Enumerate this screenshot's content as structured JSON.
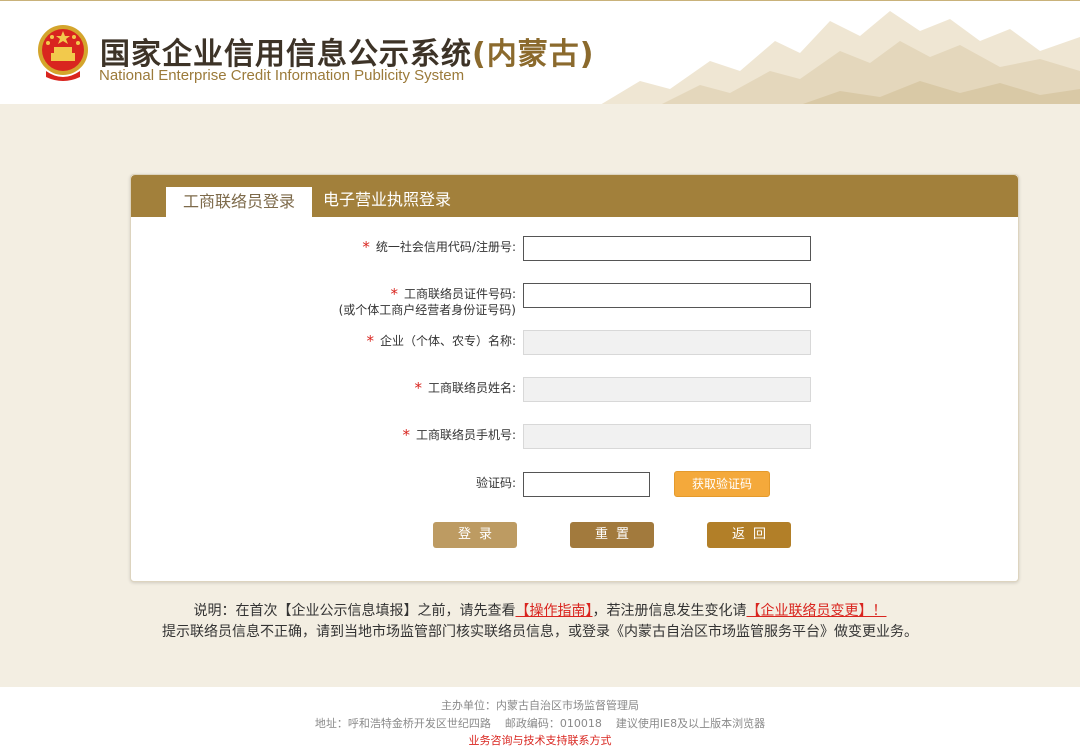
{
  "header": {
    "title_main": "国家企业信用信息公示系统",
    "title_region": "(内蒙古)",
    "subtitle": "National Enterprise Credit Information Publicity System"
  },
  "tabs": [
    {
      "label": "工商联络员登录",
      "active": true
    },
    {
      "label": "电子营业执照登录",
      "active": false
    }
  ],
  "form": {
    "required_mark": "*",
    "fields": [
      {
        "label": "统一社会信用代码/注册号:",
        "value": "",
        "disabled": false
      },
      {
        "label": "工商联络员证件号码:",
        "label_line2": "(或个体工商户经营者身份证号码)",
        "value": "",
        "disabled": false
      },
      {
        "label": "企业（个体、农专）名称:",
        "value": "",
        "disabled": true
      },
      {
        "label": "工商联络员姓名:",
        "value": "",
        "disabled": true
      },
      {
        "label": "工商联络员手机号:",
        "value": "",
        "disabled": true
      }
    ],
    "captcha": {
      "label": "验证码:",
      "value": "",
      "button_label": "获取验证码"
    },
    "buttons": {
      "login": "登录",
      "reset": "重置",
      "back": "返回"
    }
  },
  "notes": {
    "line1_prefix": "说明：在首次【企业公示信息填报】之前，请先查看",
    "line1_link1": "【操作指南】",
    "line1_middle": "，若注册信息发生变化请",
    "line1_link2": "【企业联络员变更】！",
    "line2": "提示联络员信息不正确，请到当地市场监管部门核实联络员信息，或登录《内蒙古自治区市场监管服务平台》做变更业务。"
  },
  "footer": {
    "sponsor": "主办单位：内蒙古自治区市场监督管理局",
    "address": "地址：呼和浩特金桥开发区世纪四路    邮政编码：010018    建议使用IE8及以上版本浏览器",
    "contact_link": "业务咨询与技术支持联系方式"
  },
  "colors": {
    "tabbar": "#a2803b",
    "accent_orange": "#f4a93b",
    "required_red": "#d9251f"
  }
}
